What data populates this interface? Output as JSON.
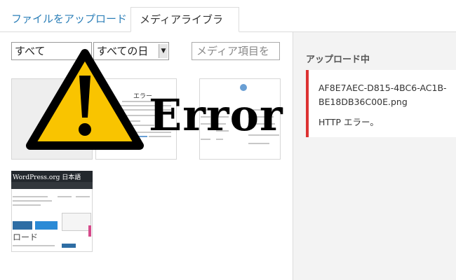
{
  "tabs": {
    "upload": "ファイルをアップロード",
    "library": "メディアライブラリ"
  },
  "toolbar": {
    "type_filter": "すべて",
    "date_filter": "すべての日",
    "search_placeholder": "メディア項目を"
  },
  "thumbnails": {
    "error_heading": "エラー",
    "wp_logo": "WordPress.org 日本語",
    "wp_title": "ロード"
  },
  "overlay": {
    "error_word": "Error"
  },
  "uploads": {
    "title": "アップロード中",
    "file_name": "AF8E7AEC-D815-4BC6-AC1B-BE18DB36C00E.png",
    "error_message": "HTTP エラー。"
  },
  "colors": {
    "link": "#2c7fb8",
    "error_border": "#dc3232",
    "warning_yellow": "#f9c400"
  }
}
